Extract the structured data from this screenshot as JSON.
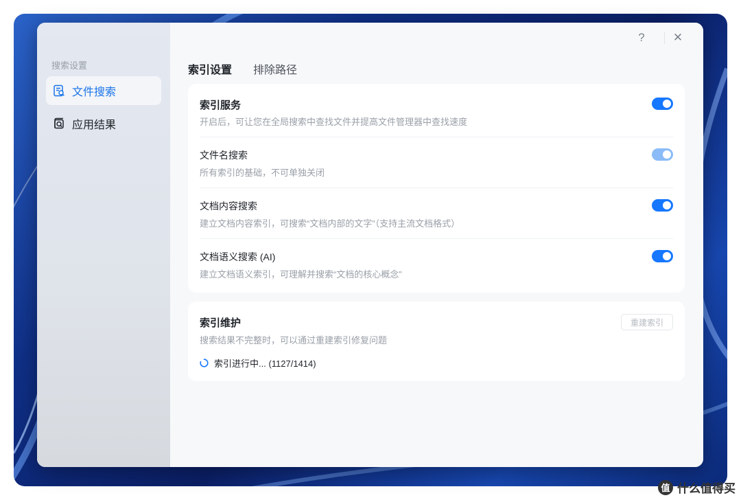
{
  "sidebar": {
    "heading": "搜索设置",
    "items": [
      {
        "label": "文件搜索",
        "icon": "file-search-icon",
        "active": true
      },
      {
        "label": "应用结果",
        "icon": "app-search-icon",
        "active": false
      }
    ]
  },
  "window_controls": {
    "help": "?",
    "close": "✕"
  },
  "tabs": [
    {
      "label": "索引设置",
      "active": true
    },
    {
      "label": "排除路径",
      "active": false
    }
  ],
  "index_service": {
    "title": "索引服务",
    "desc": "开启后，可让您在全局搜索中查找文件并提高文件管理器中查找速度",
    "enabled": true
  },
  "options": [
    {
      "title": "文件名搜索",
      "desc": "所有索引的基础，不可单独关闭",
      "enabled": true,
      "disabled": true
    },
    {
      "title": "文档内容搜索",
      "desc": "建立文档内容索引，可搜索“文档内部的文字”（支持主流文档格式）",
      "enabled": true,
      "disabled": false
    },
    {
      "title": "文档语义搜索 (AI)",
      "desc": "建立文档语义索引，可理解并搜索“文档的核心概念”",
      "enabled": true,
      "disabled": false
    }
  ],
  "maintenance": {
    "title": "索引维护",
    "desc": "搜索结果不完整时，可以通过重建索引修复问题",
    "rebuild_label": "重建索引",
    "progress_text": "索引进行中... (1127/1414)"
  },
  "watermark": {
    "logo": "值",
    "text": "什么值得买"
  },
  "colors": {
    "accent": "#1677ff",
    "accent_disabled": "#8bbcf7",
    "active_nav_text": "#1a73e8"
  }
}
